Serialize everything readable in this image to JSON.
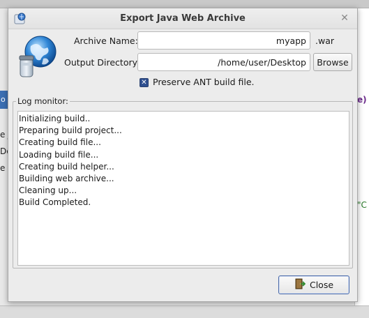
{
  "dialog": {
    "title": "Export Java Web Archive",
    "archive_name_label": "Archive Name:",
    "archive_name_value": "myapp",
    "archive_suffix": ".war",
    "output_dir_label": "Output Directory:",
    "output_dir_value": "/home/user/Desktop",
    "browse_label": "Browse",
    "preserve_label": "Preserve ANT build file.",
    "preserve_checked": true,
    "log_legend": "Log monitor:",
    "log_lines": [
      "Initializing build..",
      "Preparing build project...",
      "Creating build file...",
      "Loading build file...",
      "Creating build helper...",
      "Building web archive...",
      "Cleaning up...",
      "Build Completed."
    ],
    "close_label": "Close"
  },
  "background": {
    "left_blue_text": "o A",
    "left_fragments": [
      "e J",
      "Dep",
      "e v"
    ],
    "right_fragments": [
      "e)",
      "\"C"
    ]
  },
  "colors": {
    "accent": "#2f4f8f",
    "close_border": "#4a6aa8",
    "dialog_bg": "#ececec"
  }
}
